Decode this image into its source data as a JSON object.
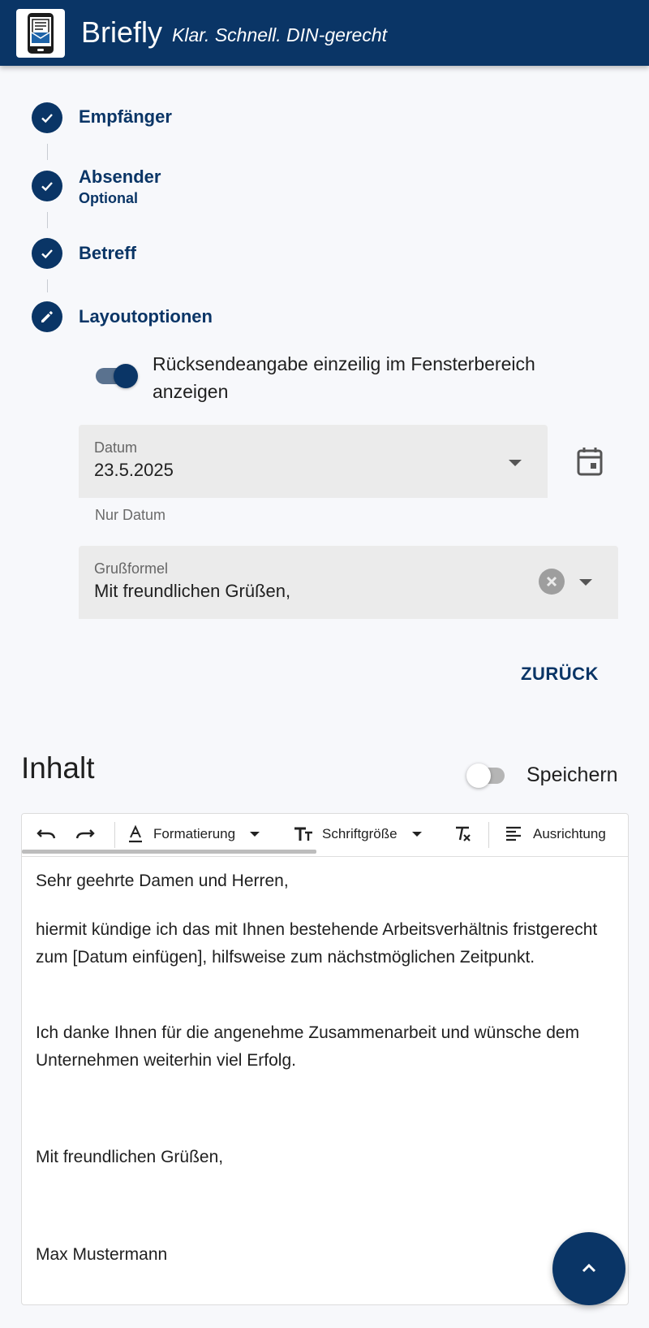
{
  "app": {
    "name": "Briefly",
    "tagline": "Klar. Schnell. DIN-gerecht"
  },
  "stepper": {
    "steps": [
      {
        "label": "Empfänger",
        "state": "completed"
      },
      {
        "label": "Absender",
        "sublabel": "Optional",
        "state": "completed"
      },
      {
        "label": "Betreff",
        "state": "completed"
      },
      {
        "label": "Layoutoptionen",
        "state": "editing"
      }
    ]
  },
  "layout_options": {
    "return_address_toggle": {
      "label": "Rücksendeangabe einzeilig im Fensterbereich anzeigen",
      "checked": true
    },
    "date_field": {
      "label": "Datum",
      "value": "23.5.2025",
      "hint": "Nur Datum"
    },
    "closing_field": {
      "label": "Grußformel",
      "value": "Mit freundlichen Grüßen,"
    },
    "back_button": "ZURÜCK"
  },
  "content_section": {
    "title": "Inhalt",
    "save_toggle": {
      "label": "Speichern",
      "checked": false
    }
  },
  "editor": {
    "toolbar": {
      "formatting": "Formatierung",
      "font_size": "Schriftgröße",
      "alignment": "Ausrichtung"
    },
    "paragraphs": [
      "Sehr geehrte Damen und Herren,",
      "hiermit kündige ich das mit Ihnen bestehende Arbeitsverhältnis fristgerecht zum [Datum einfügen], hilfsweise zum nächstmöglichen Zeitpunkt.",
      "Ich danke Ihnen für die angenehme Zusammenarbeit und wünsche dem Unternehmen weiterhin viel Erfolg.",
      "Mit freundlichen Grüßen,",
      "Max Mustermann"
    ]
  },
  "colors": {
    "primary": "#0a3566",
    "background": "#f7f8fb",
    "field_background": "#ebebeb"
  },
  "icons": {
    "logo": "letter-envelope-phone-icon",
    "step_completed": "check-icon",
    "step_editing": "pencil-icon",
    "calendar": "calendar-icon",
    "clear": "clear-icon",
    "undo": "undo-icon",
    "redo": "redo-icon",
    "fab": "chevron-up-icon"
  }
}
